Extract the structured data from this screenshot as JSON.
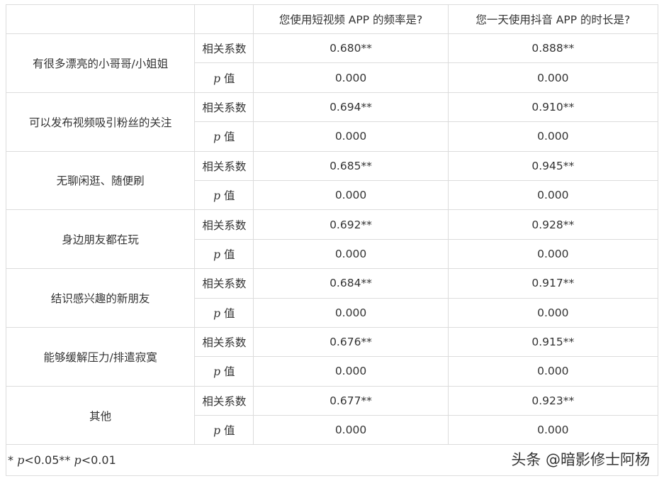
{
  "header": {
    "col3": "您使用短视频 APP 的频率是?",
    "col4": "您一天使用抖音 APP 的时长是?"
  },
  "stat_labels": {
    "corr": "相关系数",
    "p_sym": "p",
    "p_word": " 值"
  },
  "rows": [
    {
      "factor": "有很多漂亮的小哥哥/小姐姐",
      "corr_freq": "0.680**",
      "corr_dur": "0.888**",
      "p_freq": "0.000",
      "p_dur": "0.000"
    },
    {
      "factor": "可以发布视频吸引粉丝的关注",
      "corr_freq": "0.694**",
      "corr_dur": "0.910**",
      "p_freq": "0.000",
      "p_dur": "0.000"
    },
    {
      "factor": "无聊闲逛、随便刷",
      "corr_freq": "0.685**",
      "corr_dur": "0.945**",
      "p_freq": "0.000",
      "p_dur": "0.000"
    },
    {
      "factor": "身边朋友都在玩",
      "corr_freq": "0.692**",
      "corr_dur": "0.928**",
      "p_freq": "0.000",
      "p_dur": "0.000"
    },
    {
      "factor": "结识感兴趣的新朋友",
      "corr_freq": "0.684**",
      "corr_dur": "0.917**",
      "p_freq": "0.000",
      "p_dur": "0.000"
    },
    {
      "factor": "能够缓解压力/排遣寂寞",
      "corr_freq": "0.676**",
      "corr_dur": "0.915**",
      "p_freq": "0.000",
      "p_dur": "0.000"
    },
    {
      "factor": "其他",
      "corr_freq": "0.677**",
      "corr_dur": "0.923**",
      "p_freq": "0.000",
      "p_dur": "0.000"
    }
  ],
  "footnote": {
    "star1": "* ",
    "p1": "p",
    "t1": "<0.05** ",
    "p2": "p",
    "t2": "<0.01"
  },
  "watermark": "头条 @暗影修士阿杨"
}
